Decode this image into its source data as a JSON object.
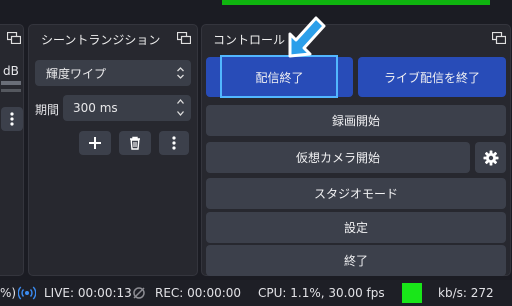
{
  "left_panel": {
    "db_label": "dB"
  },
  "transitions": {
    "title": "シーントランジション",
    "selected_transition": "輝度ワイプ",
    "duration_label": "期間",
    "duration_value": "300 ms"
  },
  "controls": {
    "title": "コントロール",
    "stop_stream": "配信終了",
    "start_live": "ライブ配信を終了",
    "start_recording": "録画開始",
    "start_virtual_cam": "仮想カメラ開始",
    "studio_mode": "スタジオモード",
    "settings": "設定",
    "exit": "終了"
  },
  "status_bar": {
    "left_fragment": "%)",
    "live": "LIVE: 00:00:13",
    "rec": "REC: 00:00:00",
    "cpu": "CPU: 1.1%, 30.00 fps",
    "kbs": "kb/s: 272",
    "indicator_color": "#19e619"
  },
  "colors": {
    "background": "#1b1c23",
    "panel": "#27282f",
    "button": "#3c404b",
    "accent_button": "#284cb8",
    "highlight_border": "#52b7ff",
    "cursor_arrow": "#2b9fea"
  }
}
